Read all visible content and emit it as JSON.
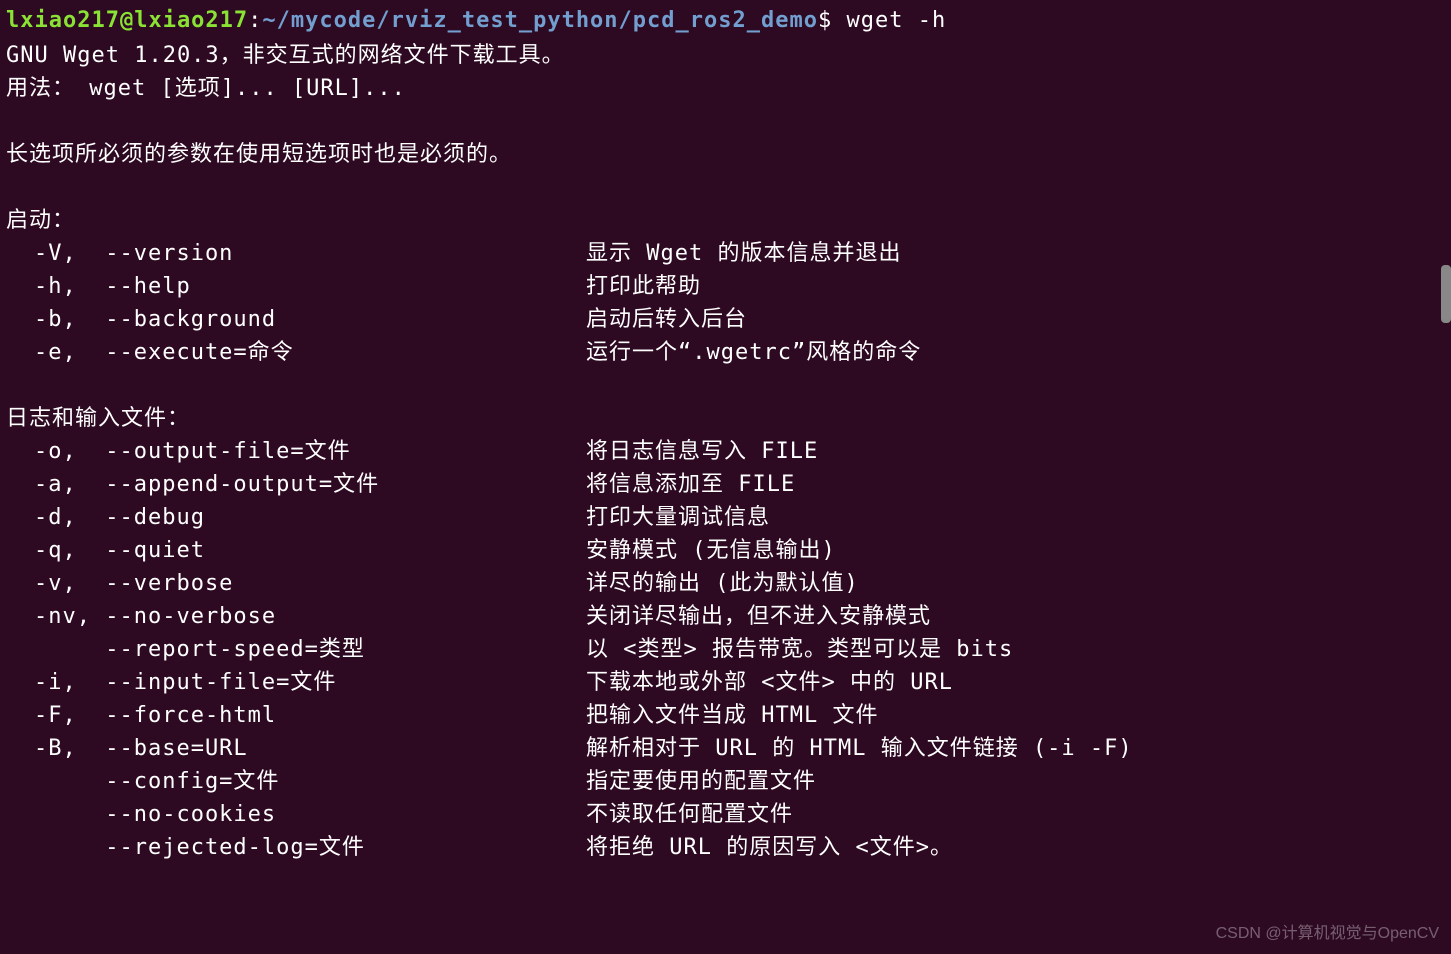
{
  "prompt": {
    "user_host": "lxiao217@lxiao217",
    "colon": ":",
    "path": "~/mycode/rviz_test_python/pcd_ros2_demo",
    "dollar": "$",
    "command": " wget -h"
  },
  "header": {
    "line1": "GNU Wget 1.20.3，非交互式的网络文件下载工具。",
    "line2": "用法： wget [选项]... [URL]..."
  },
  "mandatory_note": "长选项所必须的参数在使用短选项时也是必须的。",
  "section_startup": {
    "title": "启动：",
    "rows": [
      {
        "flags": "-V,  --version",
        "desc": "显示 Wget 的版本信息并退出"
      },
      {
        "flags": "-h,  --help",
        "desc": "打印此帮助"
      },
      {
        "flags": "-b,  --background",
        "desc": "启动后转入后台"
      },
      {
        "flags": "-e,  --execute=命令",
        "desc": "运行一个“.wgetrc”风格的命令"
      }
    ]
  },
  "section_log": {
    "title": "日志和输入文件：",
    "rows": [
      {
        "flags": "-o,  --output-file=文件",
        "desc": "将日志信息写入 FILE"
      },
      {
        "flags": "-a,  --append-output=文件",
        "desc": "将信息添加至 FILE"
      },
      {
        "flags": "-d,  --debug",
        "desc": "打印大量调试信息"
      },
      {
        "flags": "-q,  --quiet",
        "desc": "安静模式 (无信息输出)"
      },
      {
        "flags": "-v,  --verbose",
        "desc": "详尽的输出 (此为默认值)"
      },
      {
        "flags": "-nv, --no-verbose",
        "desc": "关闭详尽输出，但不进入安静模式"
      },
      {
        "flags": "     --report-speed=类型",
        "desc": "以 <类型> 报告带宽。类型可以是 bits"
      },
      {
        "flags": "-i,  --input-file=文件",
        "desc": "下载本地或外部 <文件> 中的 URL"
      },
      {
        "flags": "-F,  --force-html",
        "desc": "把输入文件当成 HTML 文件"
      },
      {
        "flags": "-B,  --base=URL",
        "desc": "解析相对于 URL 的 HTML 输入文件链接 (-i -F)"
      },
      {
        "flags": "     --config=文件",
        "desc": "指定要使用的配置文件"
      },
      {
        "flags": "     --no-cookies",
        "desc": "不读取任何配置文件"
      },
      {
        "flags": "     --rejected-log=文件",
        "desc": "将拒绝 URL 的原因写入 <文件>。"
      }
    ]
  },
  "watermark": "CSDN @计算机视觉与OpenCV"
}
